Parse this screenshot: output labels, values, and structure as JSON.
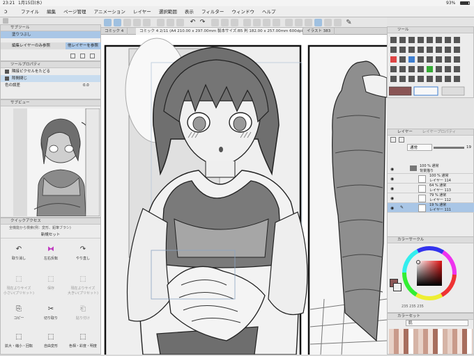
{
  "status": {
    "time": "23:21",
    "date": "1月15日(水)",
    "battery": "93%"
  },
  "menu": [
    "ファイル",
    "編集",
    "ページ管理",
    "アニメーション",
    "レイヤー",
    "選択範囲",
    "表示",
    "フィルター",
    "ウィンドウ",
    "ヘルプ"
  ],
  "subtool": {
    "title": "サブツール",
    "items": [
      {
        "label": "塗りつぶし"
      },
      {
        "label": "編集レイヤーのみ参照"
      },
      {
        "label": "他レイヤーを参照"
      }
    ]
  },
  "toolprop": {
    "title": "ツールプロパティ",
    "items": [
      {
        "label": "隣接ピクセルをたどる"
      },
      {
        "label": "隙間閉じ"
      },
      {
        "label": "色の誤差"
      }
    ],
    "tolerance": "0.0"
  },
  "subview": {
    "title": "サブビュー"
  },
  "quickaccess": {
    "title": "クイックアクセス",
    "source": "全機能から検索(例：変形、鉛筆ブラシ)",
    "set": "新規セット",
    "buttons": [
      {
        "label": "取り消し",
        "icon": "↶"
      },
      {
        "label": "左右反転",
        "icon": "⧓"
      },
      {
        "label": "やり直し",
        "icon": "↷"
      },
      {
        "label": "現在よりサイズ\n小さい(プリセット)",
        "icon": "⬚"
      },
      {
        "label": "保存",
        "icon": "⬚"
      },
      {
        "label": "現在よりサイズ\n大きい(プリセット)",
        "icon": "⬚"
      },
      {
        "label": "コピー",
        "icon": "⎘"
      },
      {
        "label": "切り取り",
        "icon": "✂"
      },
      {
        "label": "貼り付け",
        "icon": "⎗"
      },
      {
        "label": "拡大・縮小・回転",
        "icon": "⬚"
      },
      {
        "label": "自由変形",
        "icon": "⬚"
      },
      {
        "label": "色相・彩度・明度",
        "icon": "⬚"
      }
    ]
  },
  "tabs": [
    {
      "label": "コミック 4"
    },
    {
      "label": "コミック 4 2/11 (A4 210.00 x 297.00mm 製本サイズ:B5 判 182.00 x 257.00mm 600dpi 52.5%)"
    },
    {
      "label": "イラスト 383"
    }
  ],
  "tools": {
    "title": "ツール"
  },
  "layers": {
    "title": "レイヤー",
    "tab2": "レイヤープロパティ",
    "blend": "通常",
    "opacity": "19",
    "items": [
      {
        "pct": "100 % 通常",
        "name": "背景描り"
      },
      {
        "pct": "100 % 通常",
        "name": "レイヤー 114"
      },
      {
        "pct": "64 % 通常",
        "name": "レイヤー 113"
      },
      {
        "pct": "79 % 通常",
        "name": "レイヤー 112"
      },
      {
        "pct": "19 % 通常",
        "name": "レイヤー 111"
      }
    ]
  },
  "colorcircle": {
    "title": "カラーサークル",
    "values": "235 235 235"
  },
  "colorset": {
    "title": "カラーセット",
    "preset": "肌"
  },
  "colors": {
    "accent": "#a9c6e6",
    "main": "#8a5555",
    "selected": "#3f7fd0"
  }
}
